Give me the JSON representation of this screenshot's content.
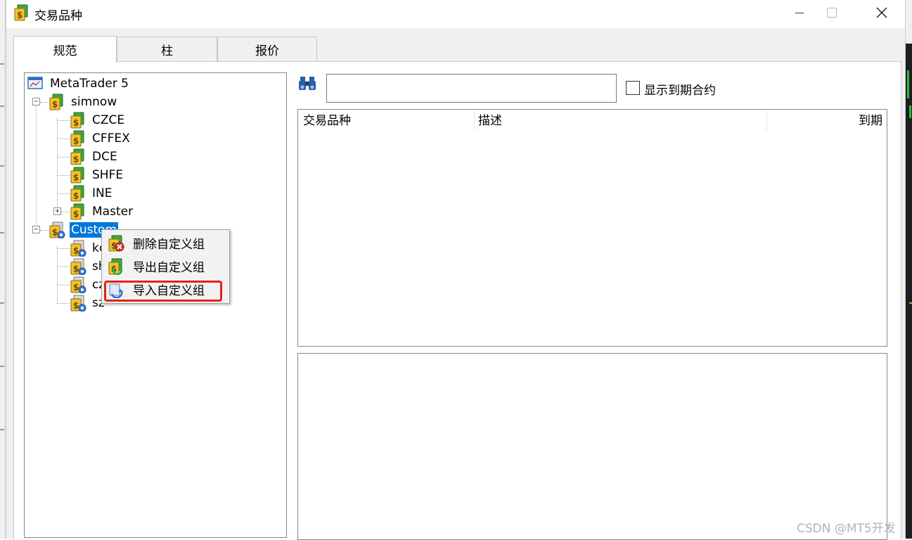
{
  "window": {
    "title": "交易品种"
  },
  "tabs": [
    {
      "label": "规范",
      "active": true
    },
    {
      "label": "柱",
      "active": false
    },
    {
      "label": "报价",
      "active": false
    }
  ],
  "tree": {
    "root": "MetaTrader 5",
    "simnow": {
      "label": "simnow",
      "children": [
        "CZCE",
        "CFFEX",
        "DCE",
        "SHFE",
        "INE",
        "Master"
      ]
    },
    "custom": {
      "label": "Custom",
      "children": [
        "kc",
        "sh",
        "cz",
        "sz"
      ]
    }
  },
  "search": {
    "value": "",
    "placeholder": ""
  },
  "show_expired": {
    "label": "显示到期合约",
    "checked": false
  },
  "list": {
    "columns": [
      "交易品种",
      "描述",
      "到期"
    ]
  },
  "context_menu": {
    "items": [
      {
        "label": "删除自定义组",
        "icon": "delete-group-icon"
      },
      {
        "label": "导出自定义组",
        "icon": "export-group-icon"
      },
      {
        "label": "导入自定义组",
        "icon": "import-group-icon"
      }
    ],
    "highlighted": "导入自定义组"
  },
  "colors": {
    "selection": "#0078d7",
    "highlight_box": "#e8201a"
  },
  "watermark": "CSDN @MT5开发"
}
